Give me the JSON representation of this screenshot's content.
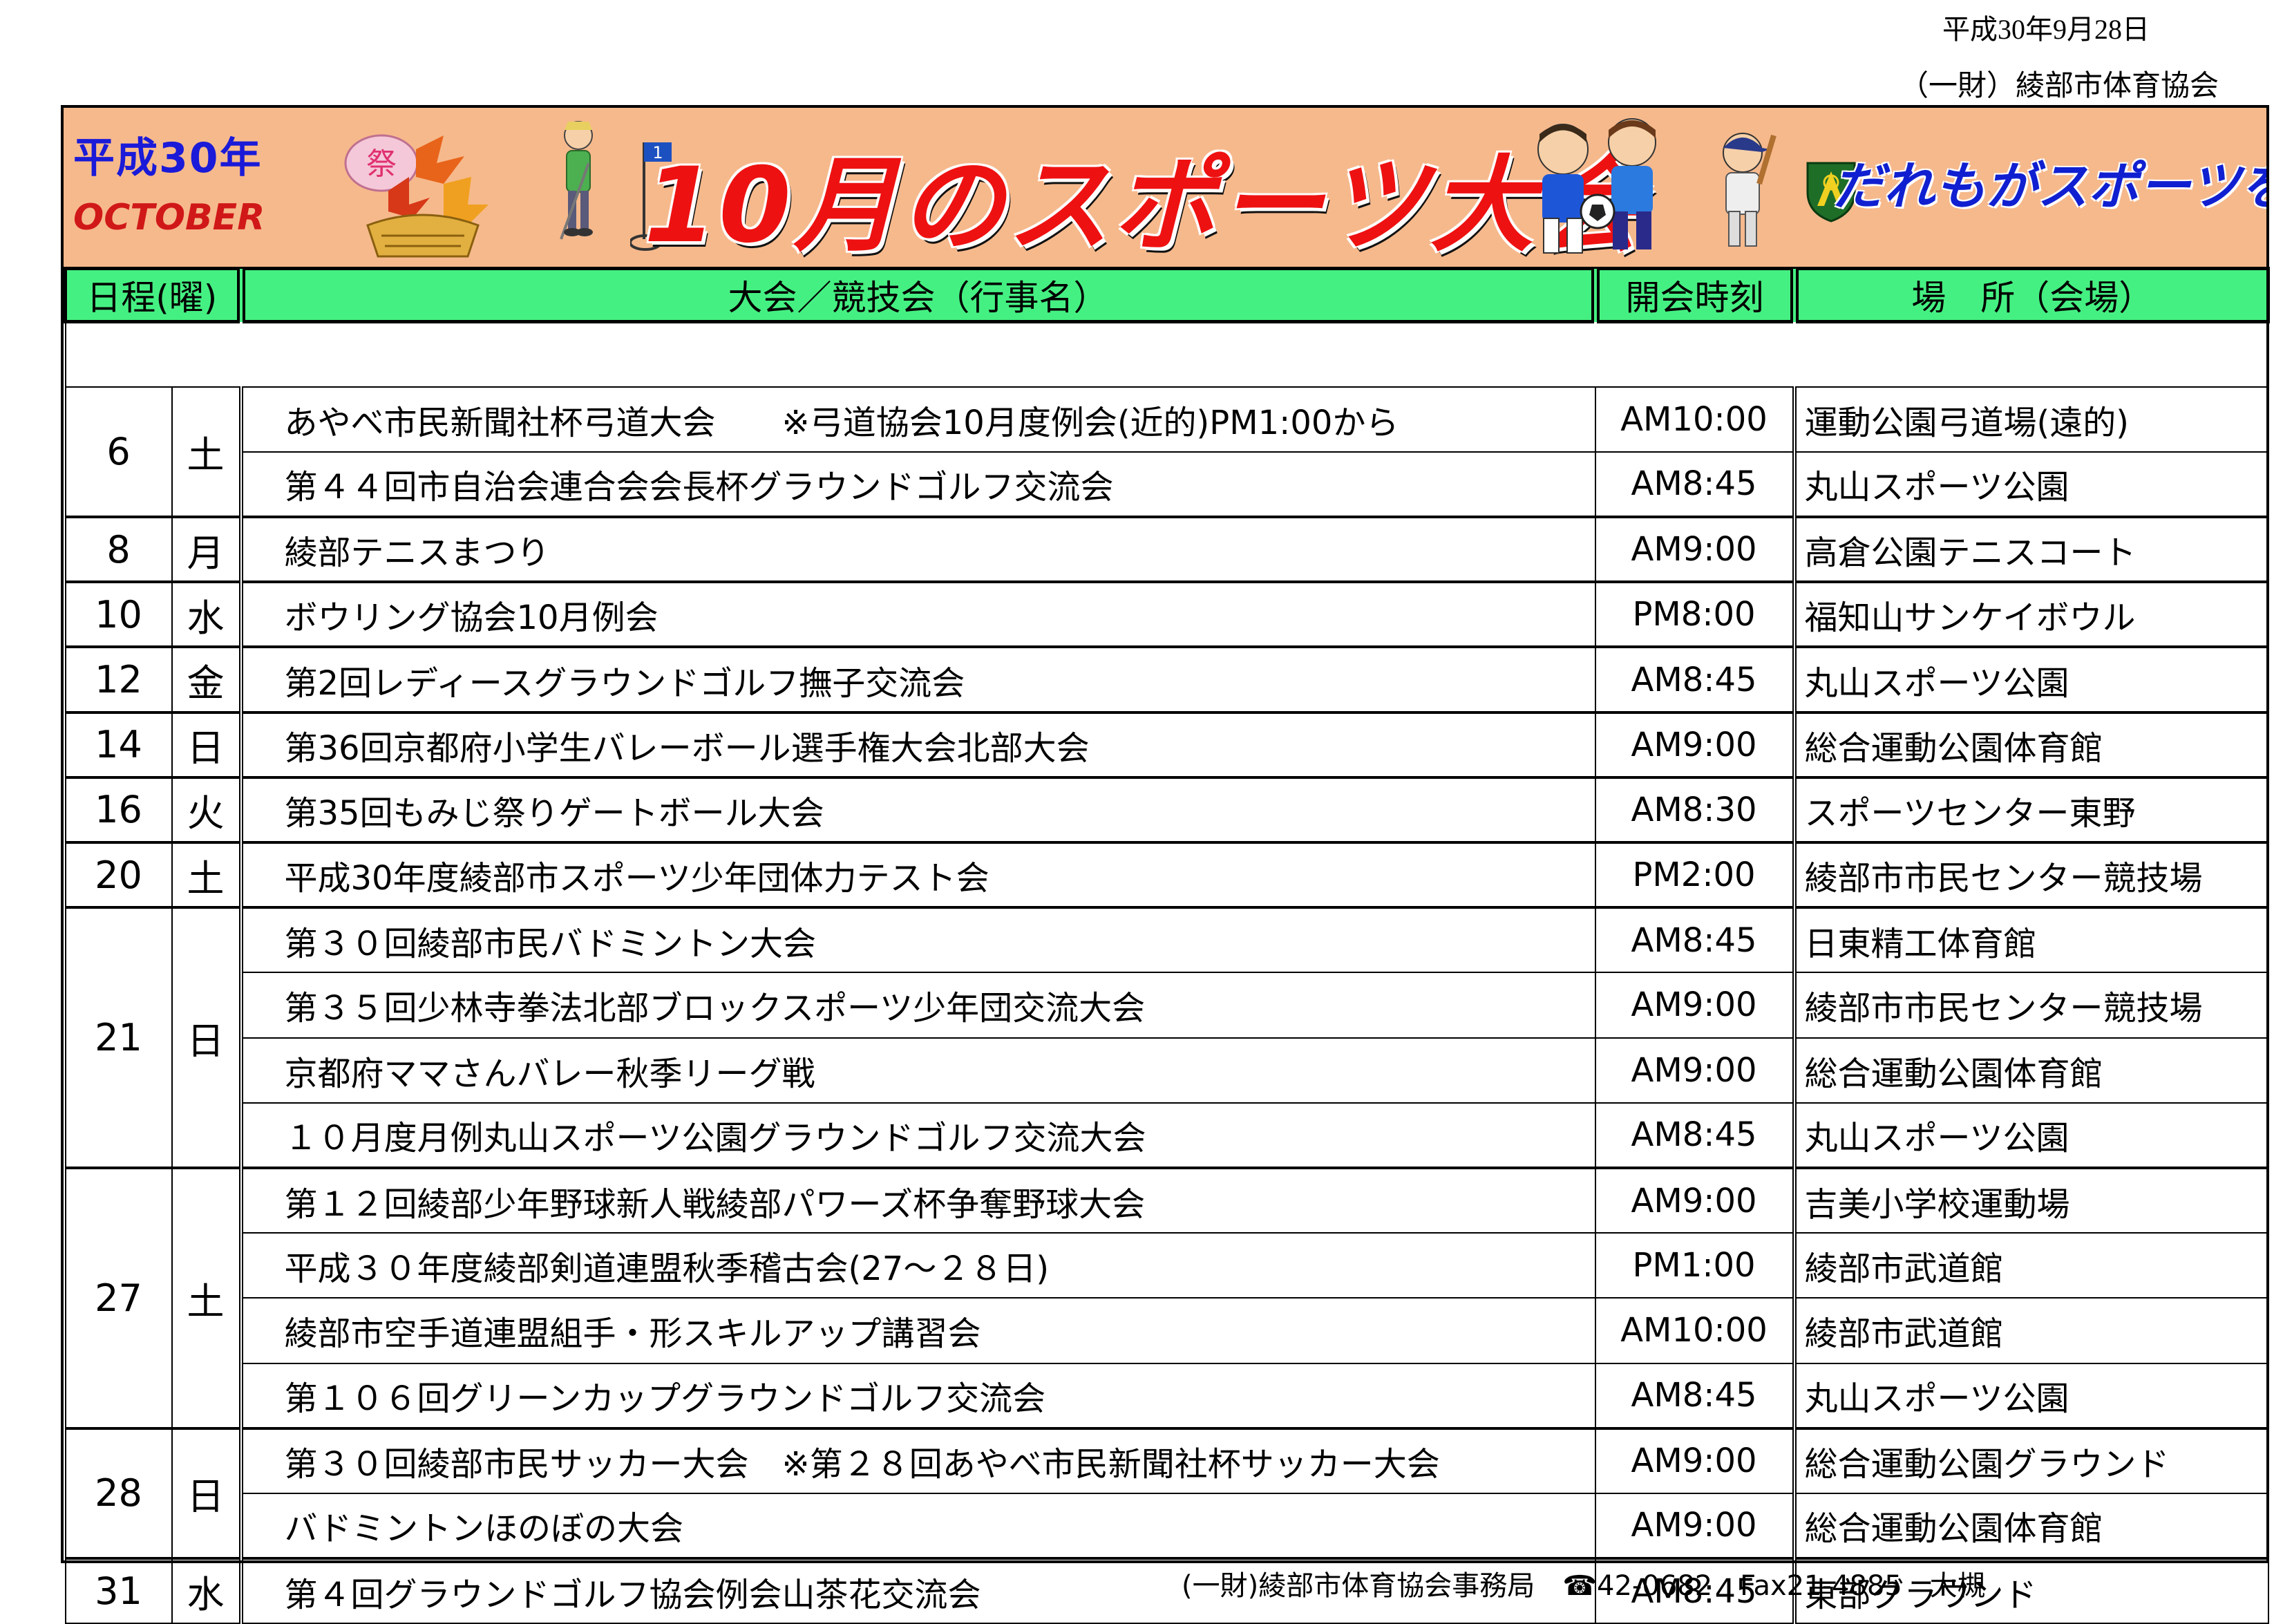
{
  "issue_date": "平成30年9月28日",
  "publisher": "（一財）綾部市体育協会",
  "banner": {
    "year": "平成30年",
    "month_en": "OCTOBER",
    "title": "10月のスポーツ大会",
    "slogan": "だれもがスポーツを！",
    "fest_char": "祭",
    "flag_number": "1",
    "colors": {
      "background": "#f6b98c",
      "title": "#ee1111",
      "slogan": "#1020d0",
      "year": "#1a1ad8"
    }
  },
  "table": {
    "headers": {
      "date": "日程(曜)",
      "event": "大会／競技会（行事名）",
      "time": "開会時刻",
      "venue": "場　所（会場）"
    },
    "header_color": "#45f082",
    "groups": [
      {
        "date": "6",
        "dow": "土",
        "rows": [
          {
            "event": "あやべ市民新聞社杯弓道大会　　※弓道協会10月度例会(近的)PM1:00から",
            "time": "AM10:00",
            "venue": "運動公園弓道場(遠的)"
          },
          {
            "event": "第４４回市自治会連合会会長杯グラウンドゴルフ交流会",
            "time": "AM8:45",
            "venue": "丸山スポーツ公園"
          }
        ]
      },
      {
        "date": "8",
        "dow": "月",
        "rows": [
          {
            "event": "綾部テニスまつり",
            "time": "AM9:00",
            "venue": "高倉公園テニスコート"
          }
        ]
      },
      {
        "date": "10",
        "dow": "水",
        "rows": [
          {
            "event": "ボウリング協会10月例会",
            "time": "PM8:00",
            "venue": "福知山サンケイボウル"
          }
        ]
      },
      {
        "date": "12",
        "dow": "金",
        "rows": [
          {
            "event": "第2回レディースグラウンドゴルフ撫子交流会",
            "time": "AM8:45",
            "venue": "丸山スポーツ公園"
          }
        ]
      },
      {
        "date": "14",
        "dow": "日",
        "rows": [
          {
            "event": "第36回京都府小学生バレーボール選手権大会北部大会",
            "time": "AM9:00",
            "venue": "総合運動公園体育館"
          }
        ]
      },
      {
        "date": "16",
        "dow": "火",
        "rows": [
          {
            "event": "第35回もみじ祭りゲートボール大会",
            "time": "AM8:30",
            "venue": "スポーツセンター東野"
          }
        ]
      },
      {
        "date": "20",
        "dow": "土",
        "rows": [
          {
            "event": "平成30年度綾部市スポーツ少年団体力テスト会",
            "time": "PM2:00",
            "venue": "綾部市市民センター競技場"
          }
        ]
      },
      {
        "date": "21",
        "dow": "日",
        "rows": [
          {
            "event": "第３０回綾部市民バドミントン大会",
            "time": "AM8:45",
            "venue": "日東精工体育館"
          },
          {
            "event": "第３５回少林寺拳法北部ブロックスポーツ少年団交流大会",
            "time": "AM9:00",
            "venue": "綾部市市民センター競技場"
          },
          {
            "event": "京都府ママさんバレー秋季リーグ戦",
            "time": "AM9:00",
            "venue": "総合運動公園体育館"
          },
          {
            "event": "１０月度月例丸山スポーツ公園グラウンドゴルフ交流大会",
            "time": "AM8:45",
            "venue": "丸山スポーツ公園"
          }
        ]
      },
      {
        "date": "27",
        "dow": "土",
        "rows": [
          {
            "event": "第１２回綾部少年野球新人戦綾部パワーズ杯争奪野球大会",
            "time": "AM9:00",
            "venue": "吉美小学校運動場"
          },
          {
            "event": "平成３０年度綾部剣道連盟秋季稽古会(27～２８日)",
            "time": "PM1:00",
            "venue": "綾部市武道館"
          },
          {
            "event": "綾部市空手道連盟組手・形スキルアップ講習会",
            "time": "AM10:00",
            "venue": "綾部市武道館"
          },
          {
            "event": "第１０６回グリーンカップグラウンドゴルフ交流会",
            "time": "AM8:45",
            "venue": "丸山スポーツ公園"
          }
        ]
      },
      {
        "date": "28",
        "dow": "日",
        "rows": [
          {
            "event": "第３０回綾部市民サッカー大会　※第２８回あやべ市民新聞社杯サッカー大会",
            "time": "AM9:00",
            "venue": "総合運動公園グラウンド"
          },
          {
            "event": "バドミントンほのぼの大会",
            "time": "AM9:00",
            "venue": "総合運動公園体育館"
          }
        ]
      },
      {
        "date": "31",
        "dow": "水",
        "rows": [
          {
            "event": "第４回グラウンドゴルフ協会例会山茶花交流会",
            "time": "AM8:45",
            "venue": "東部グラウンド"
          }
        ]
      }
    ]
  },
  "footer": "(一財)綾部市体育協会事務局　☎42-0682　Fax21-4885　大槻"
}
